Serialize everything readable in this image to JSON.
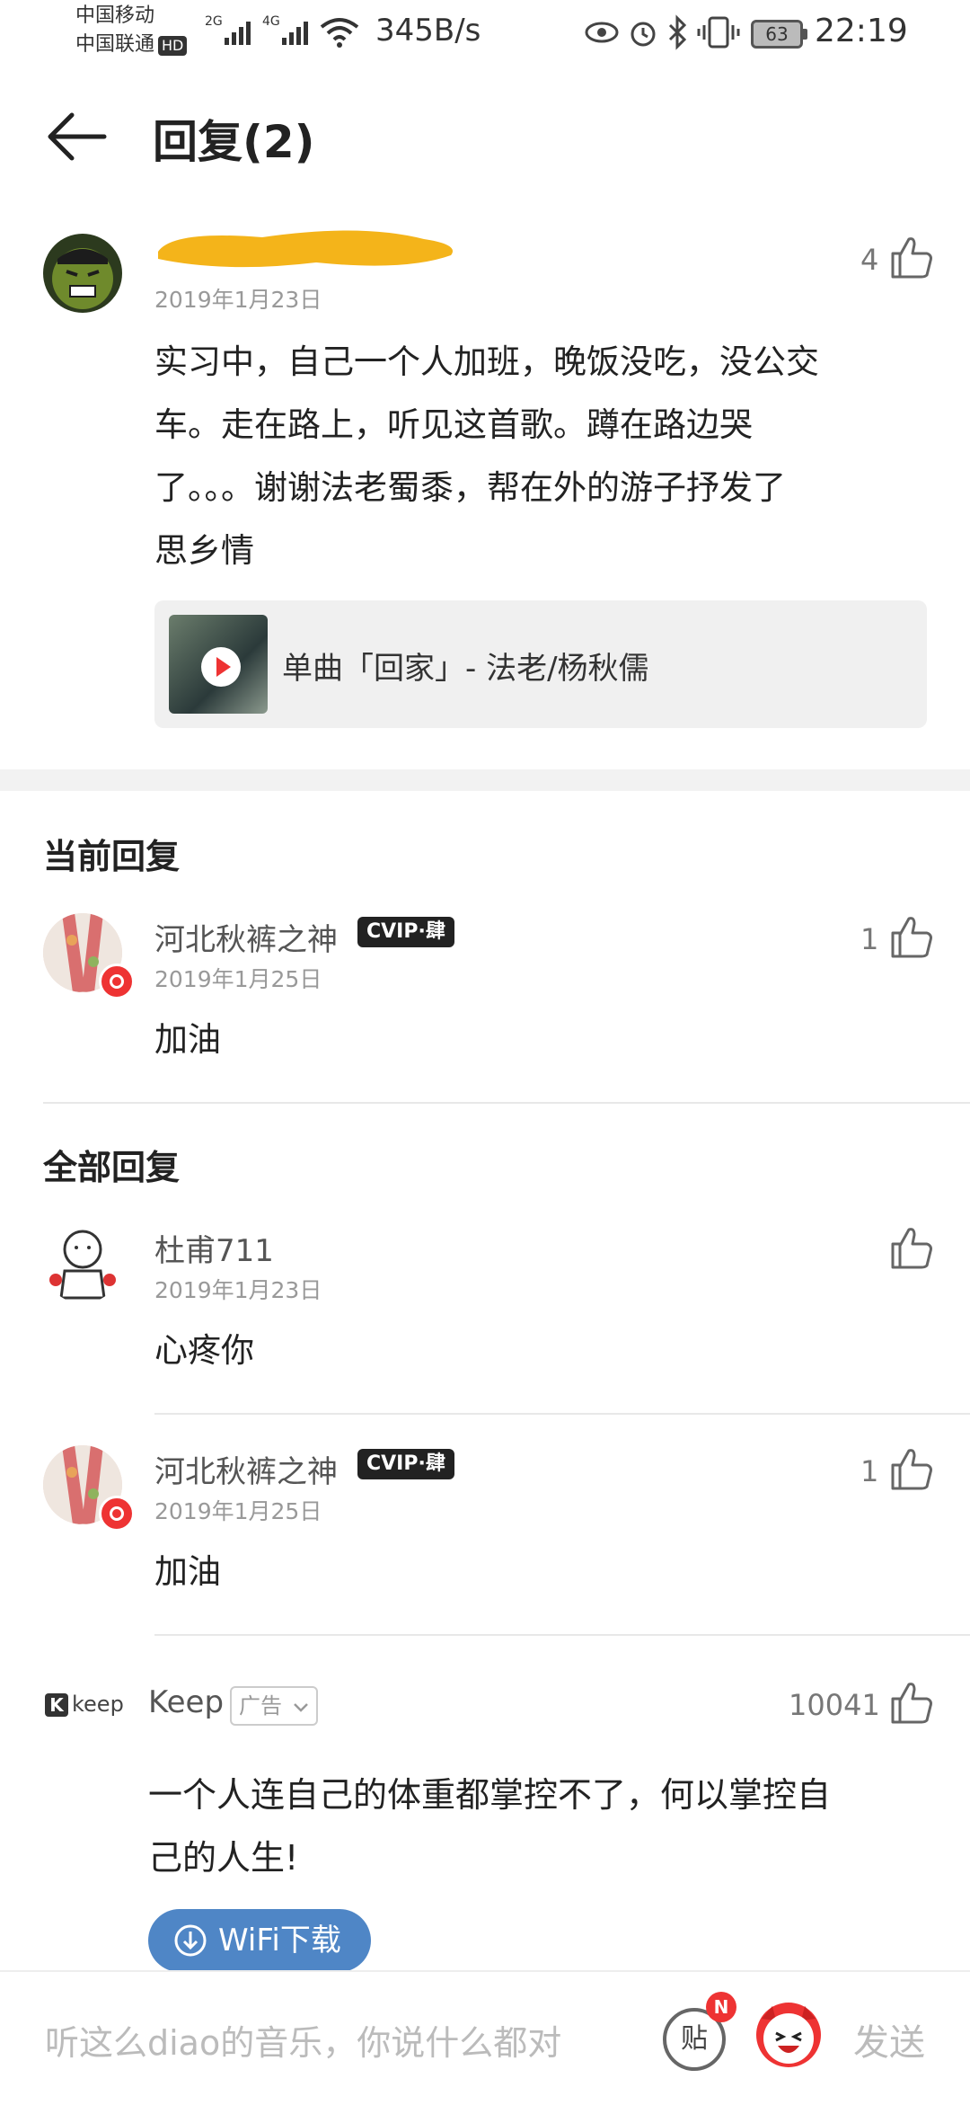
{
  "status_bar": {
    "carrier1": "中国移动",
    "carrier2": "中国联通",
    "hd": "HD",
    "net1": "2G",
    "net2": "4G",
    "speed": "345B/s",
    "battery": "63",
    "time": "22:19"
  },
  "header": {
    "title": "回复(2)"
  },
  "main_comment": {
    "username": "",
    "date": "2019年1月23日",
    "likes": "4",
    "text_lines": [
      "实习中，自己一个人加班，晚饭没吃，没公交",
      "车。走在路上，听见这首歌。蹲在路边哭",
      "了。。。谢谢法老蜀黍，帮在外的游子抒发了",
      "思乡情"
    ],
    "song": "单曲「回家」- 法老/杨秋儒"
  },
  "current_reply": {
    "section_title": "当前回复",
    "username": "河北秋裤之神",
    "vip": "CVIP·肆",
    "date": "2019年1月25日",
    "likes": "1",
    "text": "加油"
  },
  "all_replies": {
    "section_title": "全部回复",
    "items": [
      {
        "username": "杜甫711",
        "date": "2019年1月23日",
        "likes": "",
        "text": "心疼你"
      },
      {
        "username": "河北秋裤之神",
        "vip": "CVIP·肆",
        "date": "2019年1月25日",
        "likes": "1",
        "text": "加油"
      }
    ]
  },
  "ad": {
    "logo": "keep",
    "name": "Keep",
    "tag": "广告",
    "likes": "10041",
    "text_lines": [
      "一个人连自己的体重都掌控不了，何以掌控自",
      "己的人生!"
    ],
    "button": "WiFi下载"
  },
  "bottom_bar": {
    "placeholder": "听这么diao的音乐，你说什么都对",
    "tie": "贴",
    "badge": "N",
    "send": "发送"
  },
  "colors": {
    "accent_red": "#e33333",
    "button_blue": "#4f86c6",
    "ad_brand_orange": "#f4b41a"
  }
}
